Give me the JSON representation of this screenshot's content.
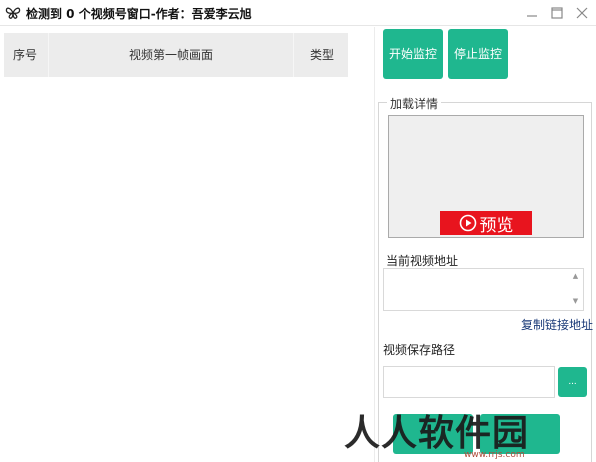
{
  "window": {
    "title": "检测到 0 个视频号窗口-作者：吾爱李云旭",
    "controls": [
      "minimize-icon",
      "maximize-icon",
      "close-icon"
    ]
  },
  "table": {
    "columns": [
      "序号",
      "视频第一帧画面",
      "类型"
    ],
    "rows": []
  },
  "actions": {
    "start_monitor": "开始监控",
    "stop_monitor": "停止监控"
  },
  "details": {
    "group_title": "加载详情",
    "preview_label": "预览",
    "current_url_label": "当前视频地址",
    "current_url_value": "",
    "copy_link_label": "复制链接地址",
    "save_path_label": "视频保存路径",
    "save_path_value": "",
    "browse_label": "..."
  },
  "watermark": {
    "text": "人人软件园",
    "url": "www.rrjs.com"
  },
  "colors": {
    "accent": "#1fb78f",
    "preview_button": "#e8141e",
    "header_bg": "#ececec",
    "link": "#1a3a78"
  }
}
